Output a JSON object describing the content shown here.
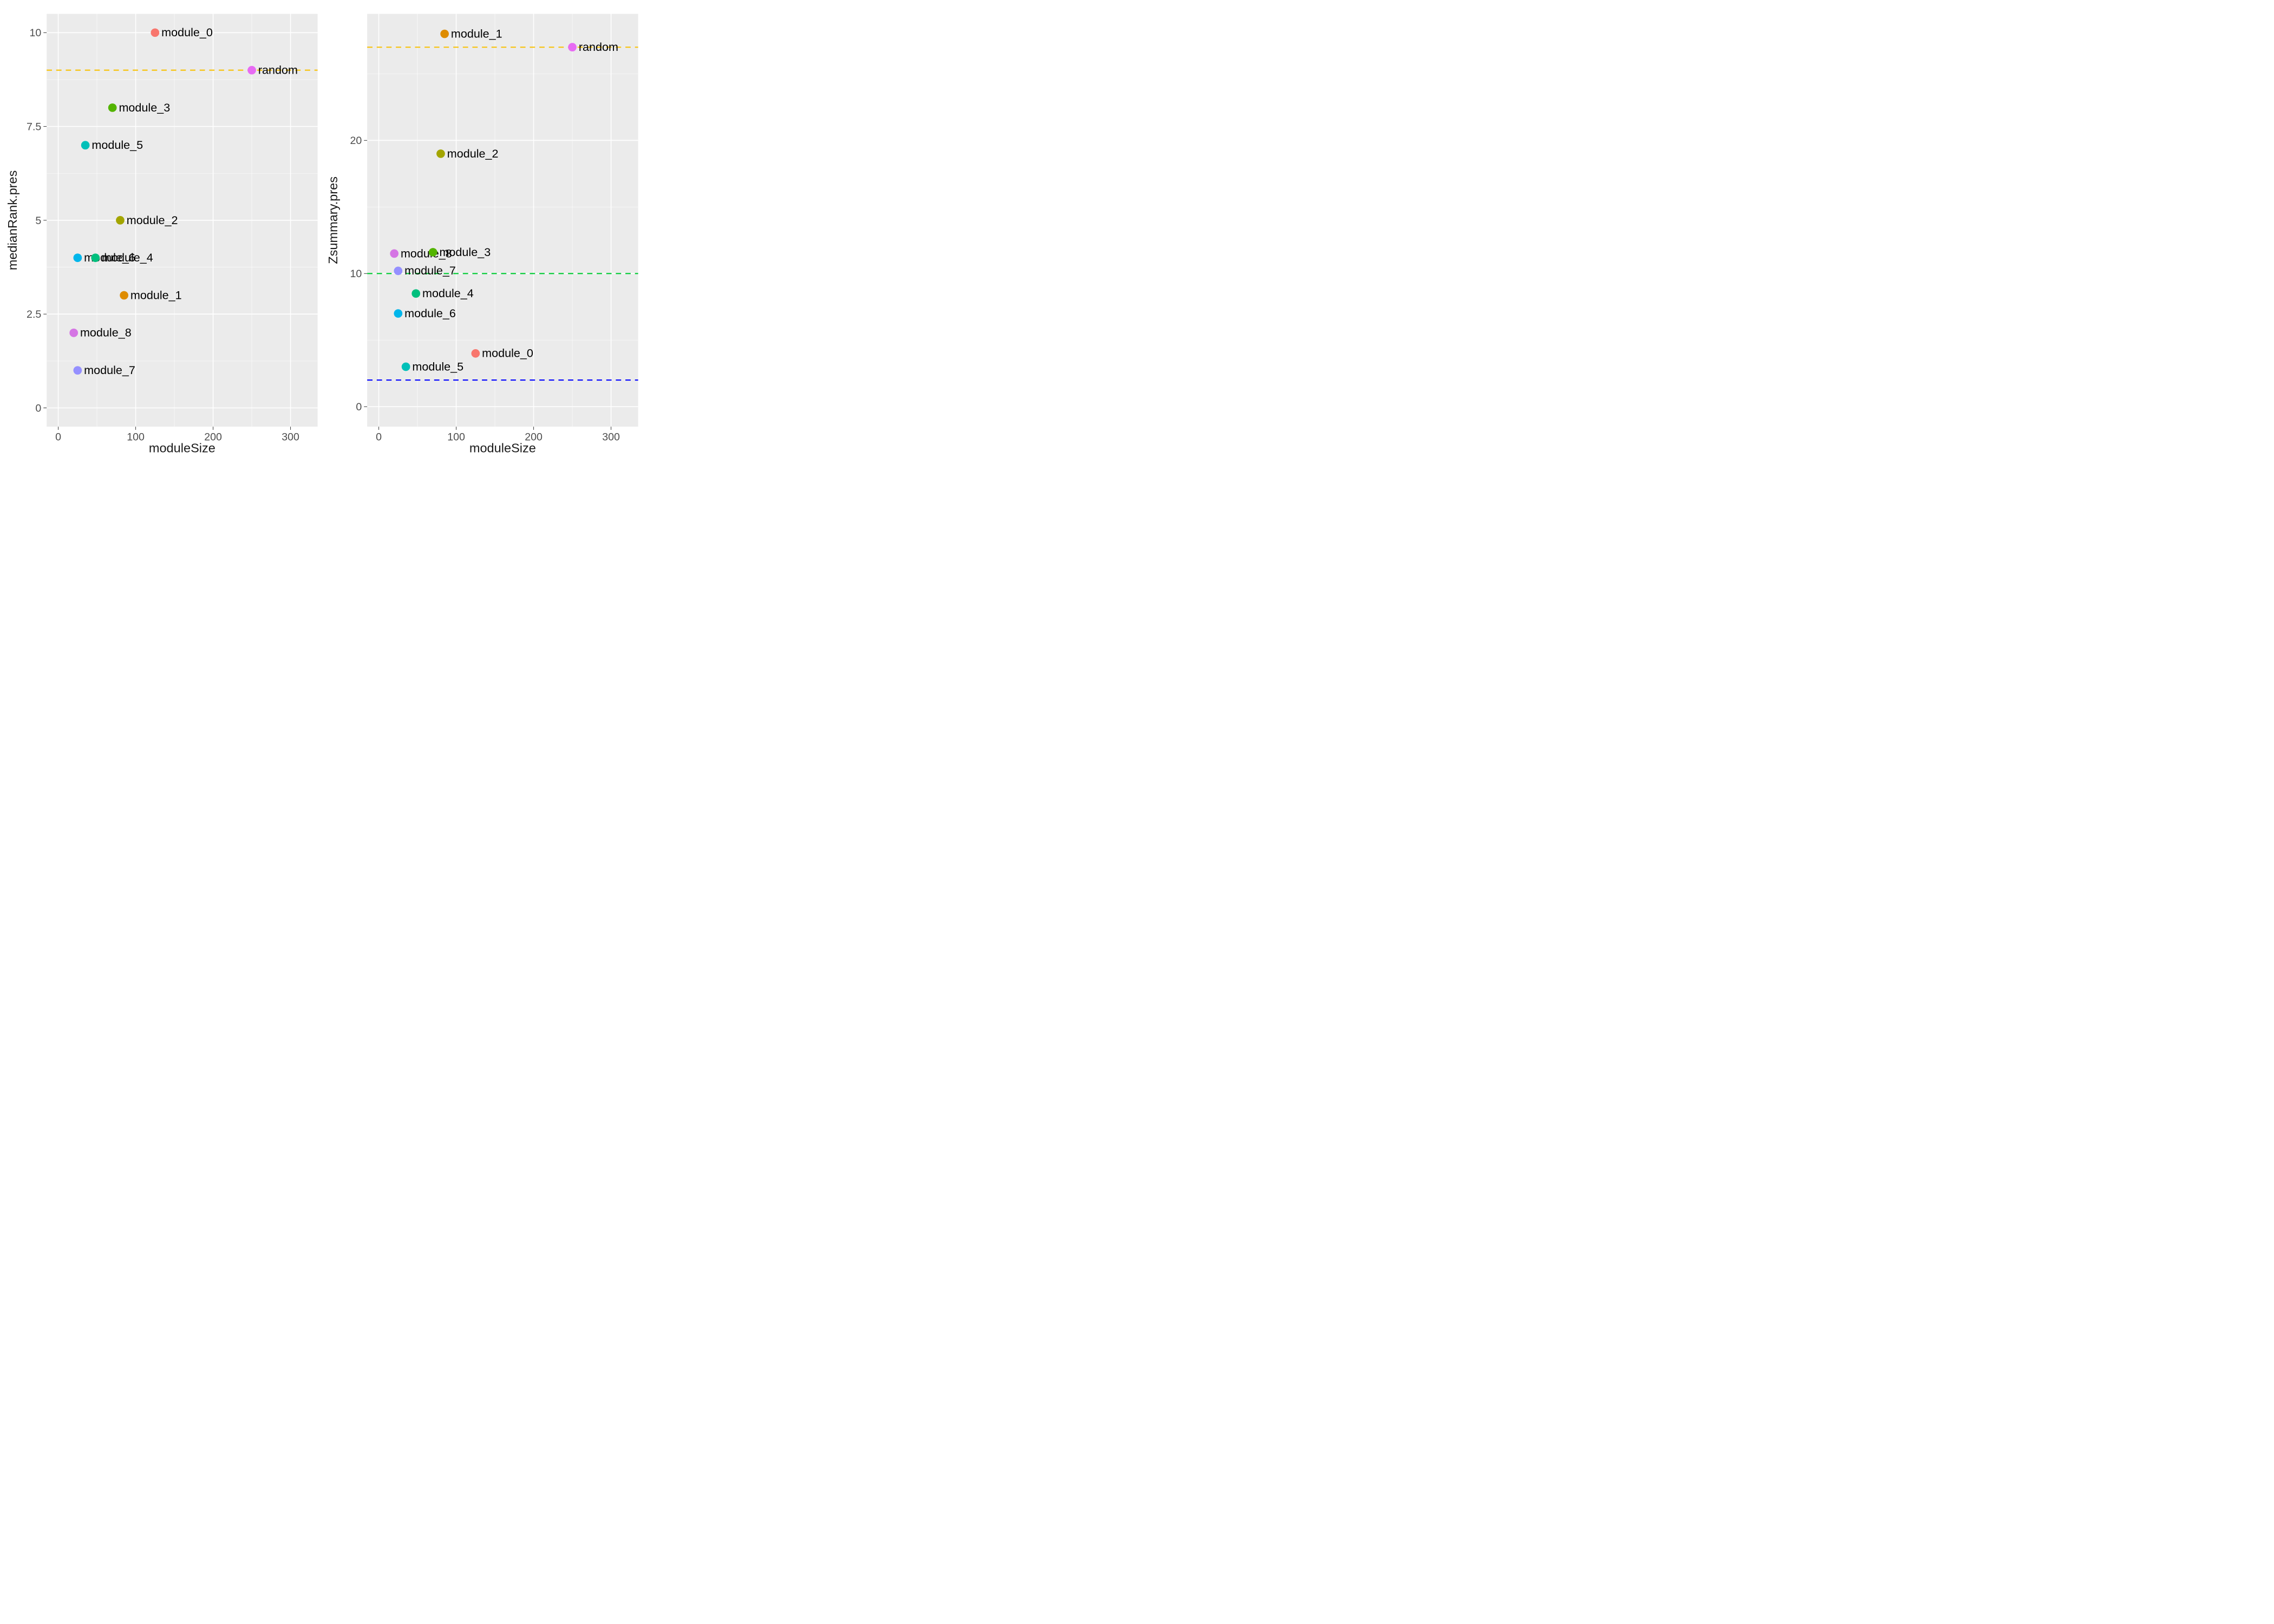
{
  "chart_data": [
    {
      "type": "scatter",
      "xlabel": "moduleSize",
      "ylabel": "medianRank.pres",
      "xlim": [
        -15,
        335
      ],
      "ylim": [
        -0.5,
        10.5
      ],
      "x_ticks": [
        0,
        100,
        200,
        300
      ],
      "y_ticks": [
        0.0,
        2.5,
        5.0,
        7.5,
        10.0
      ],
      "x_minor": [
        50,
        150,
        250
      ],
      "y_minor": [
        1.25,
        3.75,
        6.25,
        8.75
      ],
      "hlines": [
        {
          "y": 9,
          "color": "#f8c30d"
        }
      ],
      "points": [
        {
          "name": "module_0",
          "x": 125,
          "y": 10.0,
          "color": "#f8766d"
        },
        {
          "name": "random",
          "x": 250,
          "y": 9.0,
          "color": "#e76bf3"
        },
        {
          "name": "module_3",
          "x": 70,
          "y": 8.0,
          "color": "#53b400"
        },
        {
          "name": "module_5",
          "x": 35,
          "y": 7.0,
          "color": "#00c0b8"
        },
        {
          "name": "module_2",
          "x": 80,
          "y": 5.0,
          "color": "#a3a500"
        },
        {
          "name": "module_6",
          "x": 25,
          "y": 4.0,
          "color": "#00b6eb"
        },
        {
          "name": "module_4",
          "x": 48,
          "y": 4.0,
          "color": "#00bf7d"
        },
        {
          "name": "module_1",
          "x": 85,
          "y": 3.0,
          "color": "#de8c00"
        },
        {
          "name": "module_8",
          "x": 20,
          "y": 2.0,
          "color": "#d575e4"
        },
        {
          "name": "module_7",
          "x": 25,
          "y": 1.0,
          "color": "#9590ff"
        }
      ]
    },
    {
      "type": "scatter",
      "xlabel": "moduleSize",
      "ylabel": "Zsummary.pres",
      "xlim": [
        -15,
        335
      ],
      "ylim": [
        -1.5,
        29.5
      ],
      "x_ticks": [
        0,
        100,
        200,
        300
      ],
      "y_ticks": [
        0,
        10,
        20
      ],
      "x_minor": [
        50,
        150,
        250
      ],
      "y_minor": [
        5,
        15,
        25
      ],
      "hlines": [
        {
          "y": 2,
          "color": "#0000ff"
        },
        {
          "y": 10,
          "color": "#00cc33"
        },
        {
          "y": 27,
          "color": "#f8c30d"
        }
      ],
      "points": [
        {
          "name": "module_1",
          "x": 85,
          "y": 28.0,
          "color": "#de8c00"
        },
        {
          "name": "random",
          "x": 250,
          "y": 27.0,
          "color": "#e76bf3"
        },
        {
          "name": "module_2",
          "x": 80,
          "y": 19.0,
          "color": "#a3a500"
        },
        {
          "name": "module_8",
          "x": 20,
          "y": 11.5,
          "color": "#d575e4"
        },
        {
          "name": "module_3",
          "x": 70,
          "y": 11.6,
          "color": "#53b400"
        },
        {
          "name": "module_7",
          "x": 25,
          "y": 10.2,
          "color": "#9590ff"
        },
        {
          "name": "module_4",
          "x": 48,
          "y": 8.5,
          "color": "#00bf7d"
        },
        {
          "name": "module_6",
          "x": 25,
          "y": 7.0,
          "color": "#00b6eb"
        },
        {
          "name": "module_0",
          "x": 125,
          "y": 4.0,
          "color": "#f8766d"
        },
        {
          "name": "module_5",
          "x": 35,
          "y": 3.0,
          "color": "#00c0b8"
        }
      ]
    }
  ]
}
